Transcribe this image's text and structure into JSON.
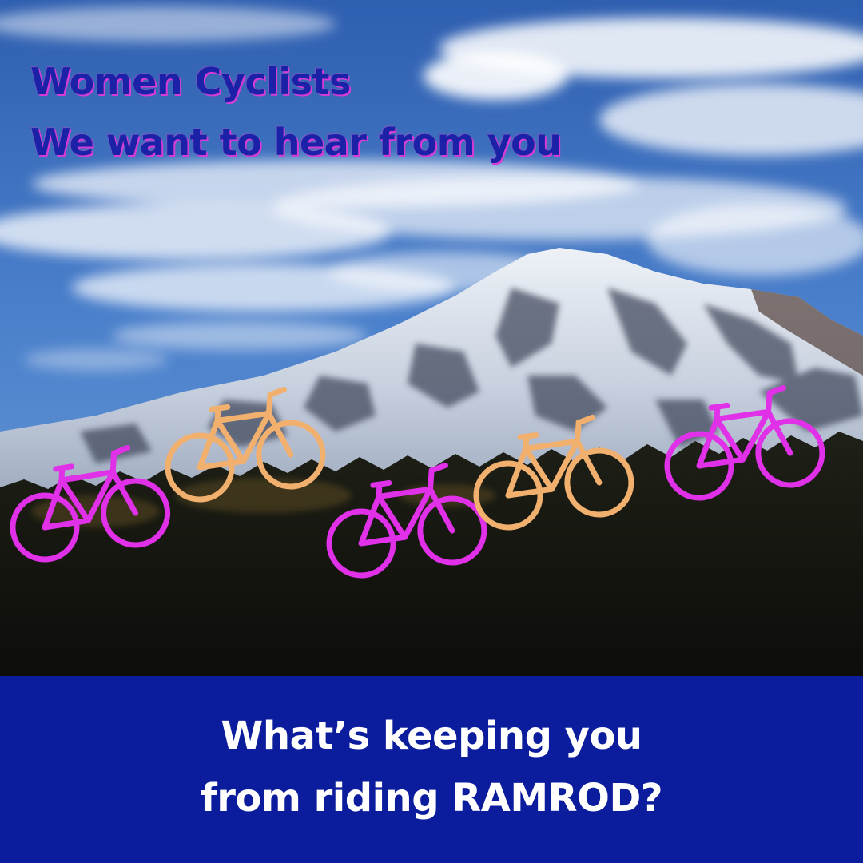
{
  "headline": {
    "line1": "Women Cyclists",
    "line2": "We want to hear from you"
  },
  "banner": {
    "line1": "What’s keeping you",
    "line2": "from riding RAMROD?",
    "background_color": "#0b1c9c"
  },
  "colors": {
    "headline_text": "#1c22a8",
    "headline_shadow": "#d63bd6",
    "bike_magenta": "#e030e8",
    "bike_orange": "#f2b06e",
    "sky": "#3a6fbf",
    "forest": "#151612"
  },
  "scene": {
    "subject": "snow-capped-mountain",
    "bicycle_icons": [
      {
        "name": "bicycle-icon-1",
        "color": "magenta"
      },
      {
        "name": "bicycle-icon-2",
        "color": "orange"
      },
      {
        "name": "bicycle-icon-3",
        "color": "magenta"
      },
      {
        "name": "bicycle-icon-4",
        "color": "orange"
      },
      {
        "name": "bicycle-icon-5",
        "color": "magenta"
      }
    ]
  }
}
